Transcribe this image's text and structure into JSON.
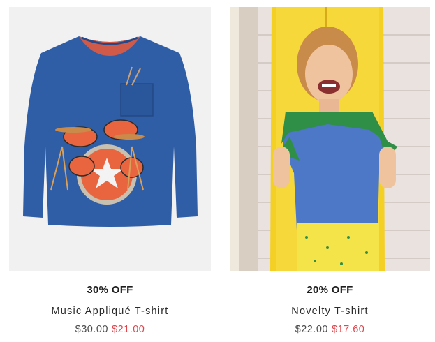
{
  "colors": {
    "sale_price": "#e1464c",
    "original_price": "#4a4a4a",
    "shirt_blue": "#2f5ea6",
    "board_yellow": "#f4cf24",
    "shorts_yellow": "#f5e34a"
  },
  "products": [
    {
      "image_icon": "tshirt-drum-applique-image",
      "discount": "30% OFF",
      "title": "Music Appliqué T-shirt",
      "was_price": "$30.00",
      "now_price": "$21.00"
    },
    {
      "image_icon": "boy-crocodile-tshirt-photo",
      "discount": "20% OFF",
      "title": "Novelty T-shirt",
      "was_price": "$22.00",
      "now_price": "$17.60"
    }
  ]
}
